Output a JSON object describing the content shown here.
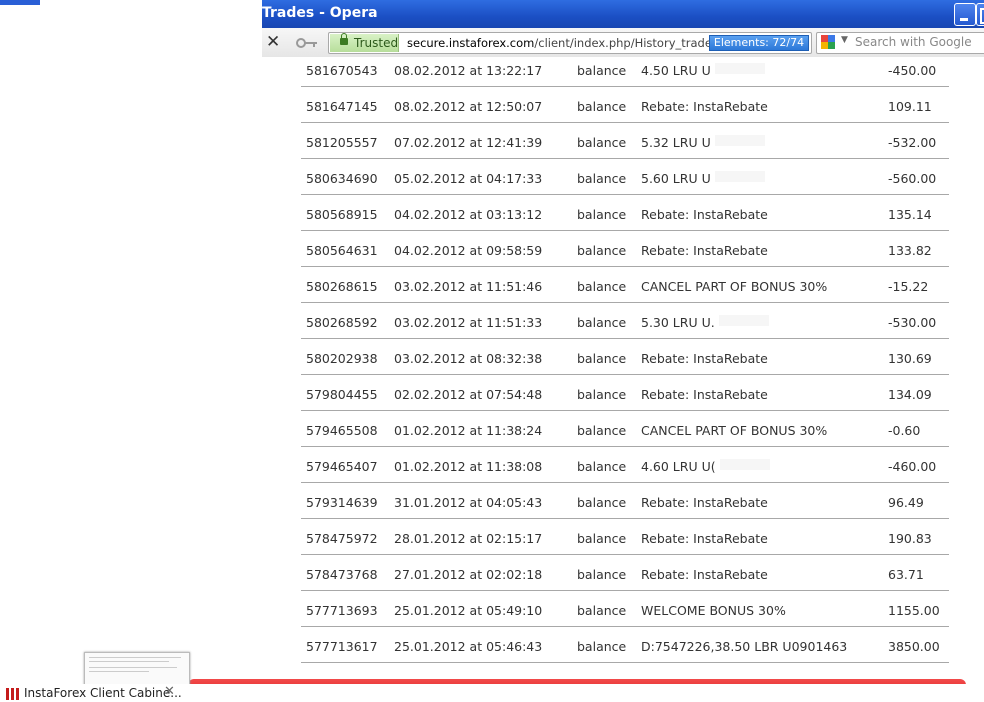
{
  "window": {
    "title": "Trades - Opera"
  },
  "toolbar": {
    "close_glyph": "✕",
    "security_label": "Trusted",
    "url_domain": "secure.instaforex.com",
    "url_path": "/client/index.php/History_trades",
    "elements_badge": "Elements: 72/74",
    "search_placeholder": "Search with Google",
    "dropdown_glyph": "▼"
  },
  "trades": [
    {
      "id": "581670543",
      "date": "08.02.2012 at 13:22:17",
      "type": "balance",
      "comment": "4.50 LRU U",
      "amount": "-450.00",
      "redacted": true
    },
    {
      "id": "581647145",
      "date": "08.02.2012 at 12:50:07",
      "type": "balance",
      "comment": "Rebate: InstaRebate",
      "amount": "109.11"
    },
    {
      "id": "581205557",
      "date": "07.02.2012 at 12:41:39",
      "type": "balance",
      "comment": "5.32 LRU U",
      "amount": "-532.00",
      "redacted": true
    },
    {
      "id": "580634690",
      "date": "05.02.2012 at 04:17:33",
      "type": "balance",
      "comment": "5.60 LRU U",
      "amount": "-560.00",
      "redacted": true
    },
    {
      "id": "580568915",
      "date": "04.02.2012 at 03:13:12",
      "type": "balance",
      "comment": "Rebate: InstaRebate",
      "amount": "135.14"
    },
    {
      "id": "580564631",
      "date": "04.02.2012 at 09:58:59",
      "type": "balance",
      "comment": "Rebate: InstaRebate",
      "amount": "133.82"
    },
    {
      "id": "580268615",
      "date": "03.02.2012 at 11:51:46",
      "type": "balance",
      "comment": "CANCEL PART OF BONUS 30%",
      "amount": "-15.22"
    },
    {
      "id": "580268592",
      "date": "03.02.2012 at 11:51:33",
      "type": "balance",
      "comment": "5.30 LRU U.",
      "amount": "-530.00",
      "redacted": true
    },
    {
      "id": "580202938",
      "date": "03.02.2012 at 08:32:38",
      "type": "balance",
      "comment": "Rebate: InstaRebate",
      "amount": "130.69"
    },
    {
      "id": "579804455",
      "date": "02.02.2012 at 07:54:48",
      "type": "balance",
      "comment": "Rebate: InstaRebate",
      "amount": "134.09"
    },
    {
      "id": "579465508",
      "date": "01.02.2012 at 11:38:24",
      "type": "balance",
      "comment": "CANCEL PART OF BONUS 30%",
      "amount": "-0.60"
    },
    {
      "id": "579465407",
      "date": "01.02.2012 at 11:38:08",
      "type": "balance",
      "comment": "4.60 LRU U(",
      "amount": "-460.00",
      "redacted": true
    },
    {
      "id": "579314639",
      "date": "31.01.2012 at 04:05:43",
      "type": "balance",
      "comment": "Rebate: InstaRebate",
      "amount": "96.49"
    },
    {
      "id": "578475972",
      "date": "28.01.2012 at 02:15:17",
      "type": "balance",
      "comment": "Rebate: InstaRebate",
      "amount": "190.83"
    },
    {
      "id": "578473768",
      "date": "27.01.2012 at 02:02:18",
      "type": "balance",
      "comment": "Rebate: InstaRebate",
      "amount": "63.71"
    },
    {
      "id": "577713693",
      "date": "25.01.2012 at 05:49:10",
      "type": "balance",
      "comment": "WELCOME BONUS 30%",
      "amount": "1155.00"
    },
    {
      "id": "577713617",
      "date": "25.01.2012 at 05:46:43",
      "type": "balance",
      "comment": "D:7547226,38.50 LBR U0901463",
      "amount": "3850.00"
    }
  ],
  "taskbar": {
    "tab_label": "InstaForex Client Cabine...",
    "tab_close_glyph": "✕"
  },
  "colors": {
    "titlebar": "#1b4fc4",
    "trusted_green": "#b7de9b",
    "elements_badge": "#2c78d8",
    "banner_red": "#d71818"
  }
}
